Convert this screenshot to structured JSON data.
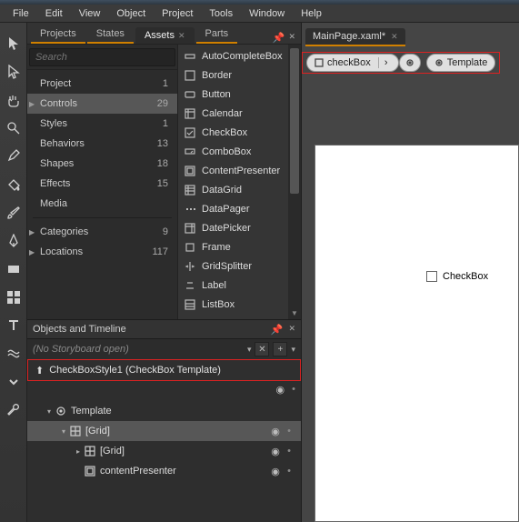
{
  "menubar": [
    "File",
    "Edit",
    "View",
    "Object",
    "Project",
    "Tools",
    "Window",
    "Help"
  ],
  "panelTabs": {
    "items": [
      "Projects",
      "States",
      "Assets",
      "Parts"
    ],
    "activeIndex": 2
  },
  "search": {
    "placeholder": "Search"
  },
  "categories": [
    {
      "name": "Project",
      "count": 1,
      "expandable": false
    },
    {
      "name": "Controls",
      "count": 29,
      "expandable": true,
      "selected": true
    },
    {
      "name": "Styles",
      "count": 1,
      "expandable": false
    },
    {
      "name": "Behaviors",
      "count": 13,
      "expandable": false
    },
    {
      "name": "Shapes",
      "count": 18,
      "expandable": false
    },
    {
      "name": "Effects",
      "count": 15,
      "expandable": false
    },
    {
      "name": "Media",
      "count": "",
      "expandable": false
    },
    {
      "name": "Categories",
      "count": 9,
      "expandable": true,
      "divider": true
    },
    {
      "name": "Locations",
      "count": 117,
      "expandable": true
    }
  ],
  "controls": [
    "AutoCompleteBox",
    "Border",
    "Button",
    "Calendar",
    "CheckBox",
    "ComboBox",
    "ContentPresenter",
    "DataGrid",
    "DataPager",
    "DatePicker",
    "Frame",
    "GridSplitter",
    "Label",
    "ListBox"
  ],
  "timeline": {
    "title": "Objects and Timeline",
    "storyboard": "(No Storyboard open)",
    "template": "CheckBoxStyle1 (CheckBox Template)",
    "tree": [
      {
        "label": "Template",
        "level": 1,
        "caret": "▾",
        "icon": "tpl"
      },
      {
        "label": "[Grid]",
        "level": 2,
        "caret": "▾",
        "icon": "grid",
        "selected": true,
        "eye": true
      },
      {
        "label": "[Grid]",
        "level": 3,
        "caret": "▸",
        "icon": "grid",
        "eye": true
      },
      {
        "label": "contentPresenter",
        "level": 3,
        "caret": "",
        "icon": "cp",
        "eye": true
      }
    ]
  },
  "document": {
    "tab": "MainPage.xaml*"
  },
  "breadcrumb": {
    "root": "checkBox",
    "next": "Template"
  },
  "designer": {
    "checkbox_label": "CheckBox"
  },
  "toolIcons": [
    "cursor",
    "arrow",
    "hand",
    "zoom",
    "eyedrop",
    "bucket",
    "brush",
    "pen",
    "rect",
    "grid",
    "text",
    "swap",
    "more",
    "wrench"
  ]
}
